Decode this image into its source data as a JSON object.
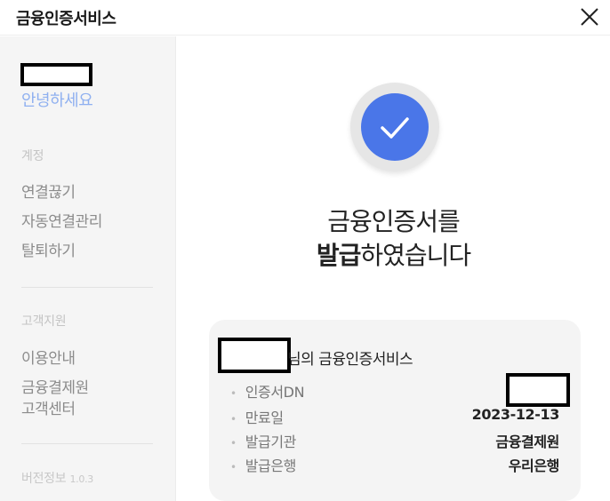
{
  "window": {
    "title": "금융인증서비스"
  },
  "sidebar": {
    "greeting": "안녕하세요",
    "account_section": {
      "label": "계정",
      "items": [
        "연결끊기",
        "자동연결관리",
        "탈퇴하기"
      ]
    },
    "support_section": {
      "label": "고객지원",
      "items": [
        "이용안내",
        "금융결제원\n고객센터"
      ]
    },
    "version_label": "버전정보",
    "version_number": "1.0.3"
  },
  "main": {
    "headline_line1": "금융인증서를",
    "headline_bold": "발급",
    "headline_rest": "하였습니다",
    "card": {
      "title_suffix": "님의 금융인증서비스",
      "rows": [
        {
          "label": "인증서DN",
          "value": ""
        },
        {
          "label": "만료일",
          "value": "2023-12-13"
        },
        {
          "label": "발급기관",
          "value": "금융결제원"
        },
        {
          "label": "발급은행",
          "value": "우리은행"
        }
      ]
    }
  },
  "colors": {
    "accent_blue": "#4a76e8",
    "greeting_blue": "#8fb0f0",
    "sidebar_bg": "#f5f5f5",
    "card_bg": "#f4f4f4"
  },
  "icons": {
    "close": "close-icon",
    "success": "checkmark-icon"
  }
}
